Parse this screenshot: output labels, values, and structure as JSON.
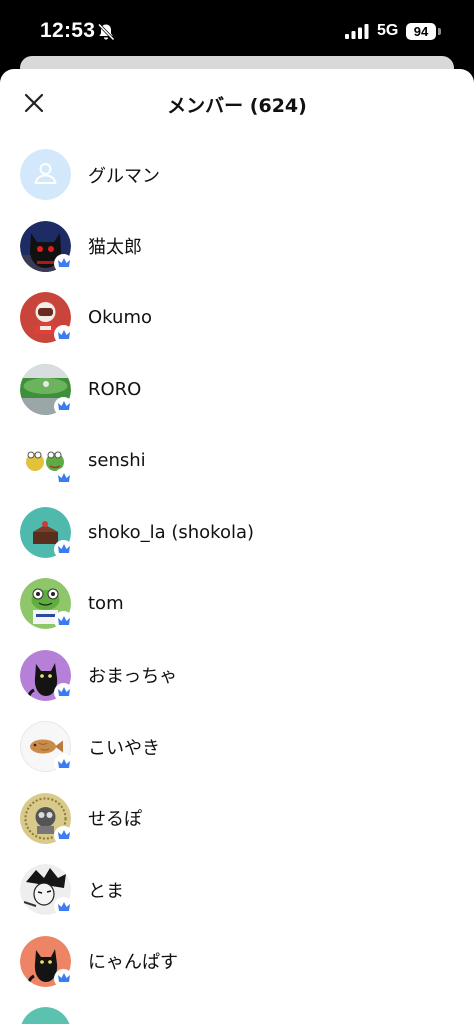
{
  "status_bar": {
    "time": "12:53",
    "network": "5G",
    "battery": "94"
  },
  "header": {
    "title": "メンバー (624)",
    "close_icon": "close-icon"
  },
  "members": [
    {
      "name": "グルマン",
      "avatar": "default-person",
      "badge": false
    },
    {
      "name": "猫太郎",
      "avatar": "black-cat-red-eyes",
      "badge": true
    },
    {
      "name": "Okumo",
      "avatar": "red-astronaut",
      "badge": true
    },
    {
      "name": "RORO",
      "avatar": "green-landscape",
      "badge": true
    },
    {
      "name": "senshi",
      "avatar": "frog-pair",
      "badge": true
    },
    {
      "name": "shoko_la (shokola)",
      "avatar": "chocolate-cake",
      "badge": true
    },
    {
      "name": "tom",
      "avatar": "green-frog",
      "badge": true
    },
    {
      "name": "おまっちゃ",
      "avatar": "black-cat-purple",
      "badge": true
    },
    {
      "name": "こいやき",
      "avatar": "taiyaki-fish",
      "badge": true
    },
    {
      "name": "せるぽ",
      "avatar": "gold-medal-robot",
      "badge": true
    },
    {
      "name": "とま",
      "avatar": "manga-drawing",
      "badge": true
    },
    {
      "name": "にゃんぱす",
      "avatar": "black-cat-orange",
      "badge": true
    }
  ],
  "colors": {
    "badge": "#3d7cf0",
    "default_avatar": "#d3e8fb"
  }
}
